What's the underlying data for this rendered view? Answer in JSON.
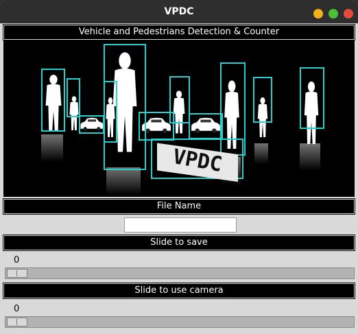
{
  "window": {
    "title": "VPDC",
    "controls": [
      "minimize",
      "maximize",
      "close"
    ],
    "colors": {
      "minimize": "#f2b01e",
      "maximize": "#4bbf36",
      "close": "#e64a3c"
    }
  },
  "header": {
    "label": "Vehicle and Pedestrians Detection & Counter"
  },
  "banner": {
    "logo_text": "VPDC",
    "box_color": "#24d1d1"
  },
  "file_name": {
    "label": "File Name",
    "value": "",
    "placeholder": ""
  },
  "save_slider": {
    "label": "Slide to save",
    "value": "0"
  },
  "camera_slider": {
    "label": "Slide to use camera",
    "value": "0"
  }
}
